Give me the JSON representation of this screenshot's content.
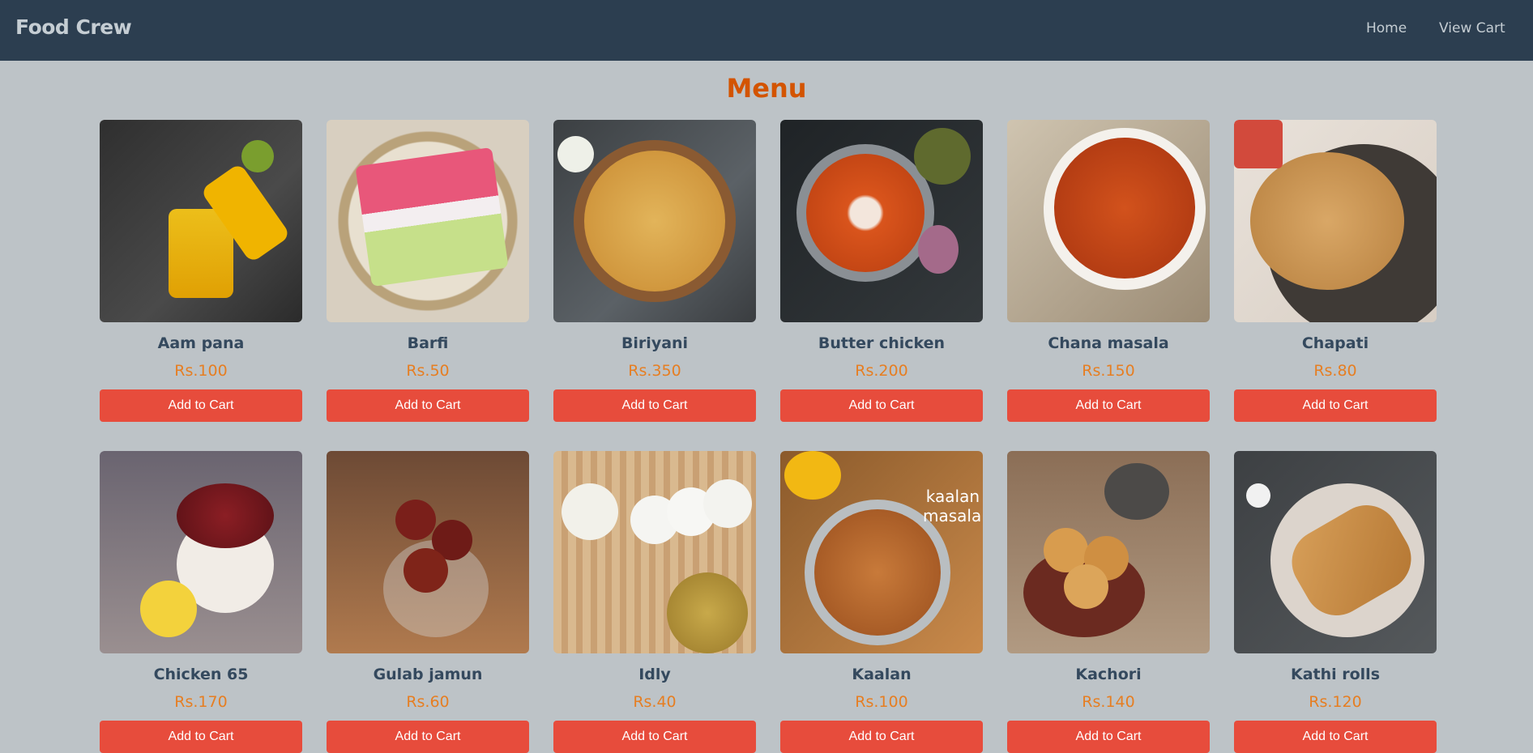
{
  "navbar": {
    "brand": "Food Crew",
    "links": {
      "home": "Home",
      "view_cart": "View Cart"
    }
  },
  "page_title": "Menu",
  "menu_items": [
    {
      "name": "Aam pana",
      "price": "Rs.100",
      "button": "Add to Cart"
    },
    {
      "name": "Barfi",
      "price": "Rs.50",
      "button": "Add to Cart"
    },
    {
      "name": "Biriyani",
      "price": "Rs.350",
      "button": "Add to Cart"
    },
    {
      "name": "Butter chicken",
      "price": "Rs.200",
      "button": "Add to Cart"
    },
    {
      "name": "Chana masala",
      "price": "Rs.150",
      "button": "Add to Cart"
    },
    {
      "name": "Chapati",
      "price": "Rs.80",
      "button": "Add to Cart"
    },
    {
      "name": "Chicken 65",
      "price": "Rs.170",
      "button": "Add to Cart"
    },
    {
      "name": "Gulab jamun",
      "price": "Rs.60",
      "button": "Add to Cart"
    },
    {
      "name": "Idly",
      "price": "Rs.40",
      "button": "Add to Cart"
    },
    {
      "name": "Kaalan",
      "price": "Rs.100",
      "button": "Add to Cart",
      "image_text": "kaalan masala"
    },
    {
      "name": "Kachori",
      "price": "Rs.140",
      "button": "Add to Cart"
    },
    {
      "name": "Kathi rolls",
      "price": "Rs.120",
      "button": "Add to Cart"
    }
  ],
  "colors": {
    "navbar_bg": "#2c3e50",
    "page_bg": "#bdc3c7",
    "title": "#d35400",
    "item_name": "#34495e",
    "price": "#e67e22",
    "button": "#e74c3c"
  }
}
